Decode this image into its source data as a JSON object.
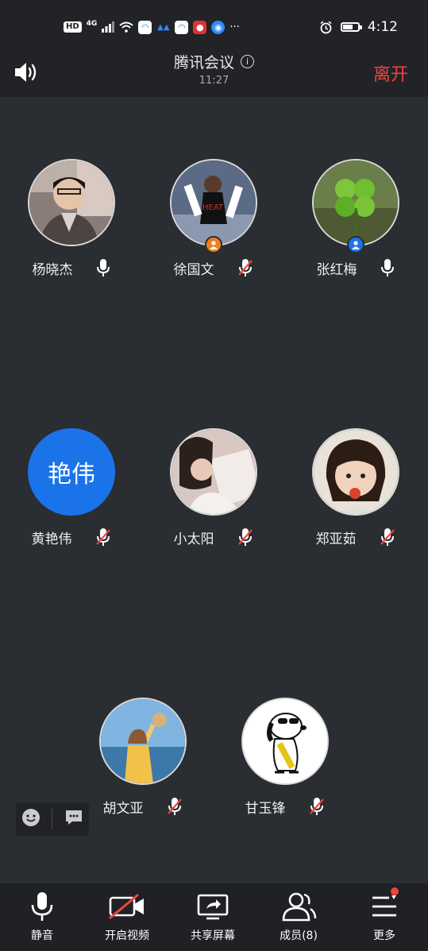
{
  "status_bar": {
    "hd": "HD",
    "network": "4G",
    "time": "4:12",
    "icons": [
      "signal-icon",
      "wifi-icon",
      "app-notification-icon",
      "alarm-icon",
      "battery-icon"
    ]
  },
  "meeting": {
    "title": "腾讯会议",
    "duration": "11:27",
    "leave_label": "离开",
    "leave_color": "#f0443c"
  },
  "participants": [
    {
      "name": "杨晓杰",
      "mic": "on",
      "badge": ""
    },
    {
      "name": "徐国文",
      "mic": "muted",
      "badge": "host"
    },
    {
      "name": "张红梅",
      "mic": "on",
      "badge": "cohost"
    },
    {
      "name": "黄艳伟",
      "mic": "muted",
      "badge": "",
      "avatar_text": "艳伟",
      "avatar_color": "#1a73e8"
    },
    {
      "name": "小太阳",
      "mic": "muted",
      "badge": ""
    },
    {
      "name": "郑亚茹",
      "mic": "muted",
      "badge": ""
    },
    {
      "name": "胡文亚",
      "mic": "muted",
      "badge": ""
    },
    {
      "name": "甘玉锋",
      "mic": "muted",
      "badge": ""
    }
  ],
  "toolbar": {
    "mute_label": "静音",
    "video_label": "开启视频",
    "share_label": "共享屏幕",
    "members_label": "成员(8)",
    "more_label": "更多"
  }
}
